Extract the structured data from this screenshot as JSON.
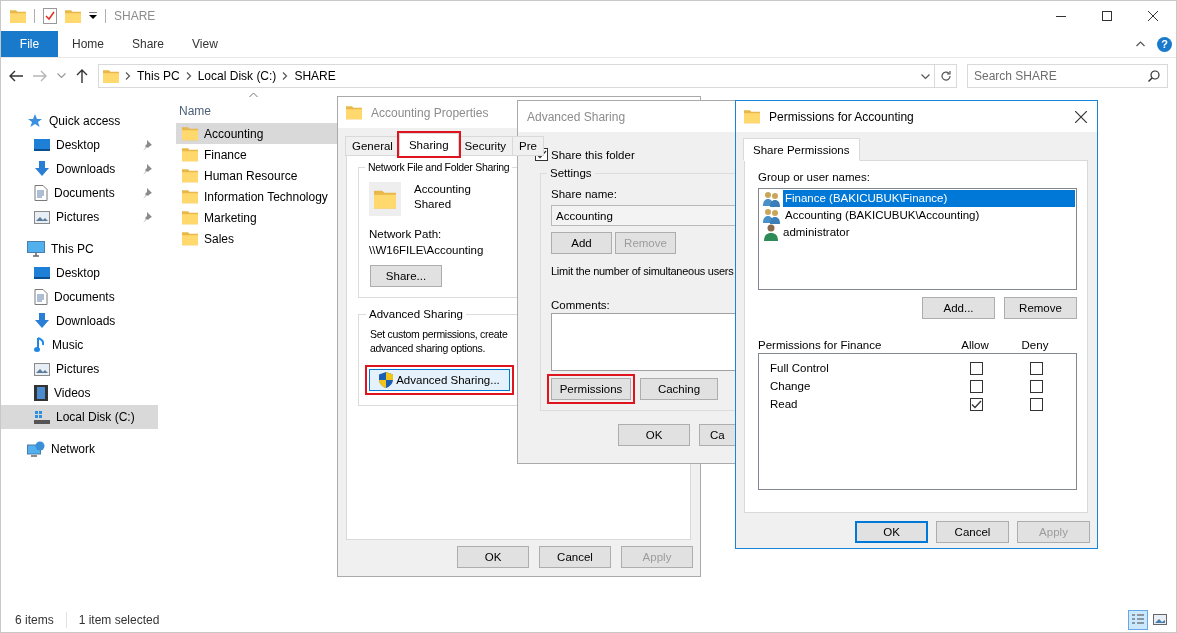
{
  "explorer": {
    "title": "SHARE",
    "ribbon_tabs": [
      {
        "label": "File",
        "kind": "file"
      },
      {
        "label": "Home",
        "kind": "tab"
      },
      {
        "label": "Share",
        "kind": "tab"
      },
      {
        "label": "View",
        "kind": "tab"
      }
    ],
    "help": "?",
    "breadcrumb": [
      "This PC",
      "Local Disk (C:)",
      "SHARE"
    ],
    "search": {
      "placeholder": "Search SHARE"
    },
    "nav": [
      {
        "label": "Quick access",
        "kind": "star",
        "selected": false,
        "children": [
          {
            "label": "Desktop",
            "kind": "desktop",
            "pinned": true,
            "selected": false
          },
          {
            "label": "Downloads",
            "kind": "downloads",
            "pinned": true,
            "selected": false
          },
          {
            "label": "Documents",
            "kind": "documents",
            "pinned": true,
            "selected": false
          },
          {
            "label": "Pictures",
            "kind": "pictures",
            "pinned": true,
            "selected": false
          }
        ]
      },
      {
        "label": "This PC",
        "kind": "pc",
        "selected": false,
        "children": [
          {
            "label": "Desktop",
            "kind": "desktop",
            "pinned": false,
            "selected": false
          },
          {
            "label": "Documents",
            "kind": "documents",
            "pinned": false,
            "selected": false
          },
          {
            "label": "Downloads",
            "kind": "downloads",
            "pinned": false,
            "selected": false
          },
          {
            "label": "Music",
            "kind": "music",
            "pinned": false,
            "selected": false
          },
          {
            "label": "Pictures",
            "kind": "pictures",
            "pinned": false,
            "selected": false
          },
          {
            "label": "Videos",
            "kind": "videos",
            "pinned": false,
            "selected": false
          },
          {
            "label": "Local Disk (C:)",
            "kind": "disk",
            "pinned": false,
            "selected": true
          }
        ]
      },
      {
        "label": "Network",
        "kind": "network",
        "selected": false
      }
    ],
    "column_header": "Name",
    "files": [
      {
        "name": "Accounting",
        "selected": true
      },
      {
        "name": "Finance",
        "selected": false
      },
      {
        "name": "Human Resource",
        "selected": false
      },
      {
        "name": "Information Technology",
        "selected": false
      },
      {
        "name": "Marketing",
        "selected": false
      },
      {
        "name": "Sales",
        "selected": false
      }
    ],
    "status_bar": {
      "count": "6 items",
      "selection": "1 item selected"
    }
  },
  "properties_dialog": {
    "title": "Accounting Properties",
    "tabs": [
      {
        "label": "General",
        "selected": false,
        "highlighted": false
      },
      {
        "label": "Sharing",
        "selected": true,
        "highlighted": true
      },
      {
        "label": "Security",
        "selected": false,
        "highlighted": false
      },
      {
        "label": "Pre",
        "selected": false,
        "highlighted": false
      }
    ],
    "network_sharing": {
      "heading": "Network File and Folder Sharing",
      "folder_name": "Accounting",
      "status": "Shared",
      "path_label": "Network Path:",
      "path": "\\\\W16FILE\\Accounting",
      "share_button": "Share..."
    },
    "advanced_sharing": {
      "heading": "Advanced Sharing",
      "description": [
        "Set custom permissions, create",
        "advanced sharing options."
      ],
      "button": {
        "label": "Advanced Sharing...",
        "highlighted": true
      }
    },
    "buttons": [
      {
        "label": "OK",
        "disabled": false
      },
      {
        "label": "Cancel",
        "disabled": false
      },
      {
        "label": "Apply",
        "disabled": true
      }
    ]
  },
  "advanced_sharing_dialog": {
    "title": "Advanced Sharing",
    "share_checkbox": {
      "label": "Share this folder",
      "checked": true
    },
    "settings_heading": "Settings",
    "share_name_label": "Share name:",
    "share_name": "Accounting",
    "name_buttons": [
      {
        "label": "Add",
        "disabled": false
      },
      {
        "label": "Remove",
        "disabled": true
      }
    ],
    "limit_text": "Limit the number of simultaneous users",
    "comments_label": "Comments:",
    "action_buttons": [
      {
        "label": "Permissions",
        "highlighted": true
      },
      {
        "label": "Caching",
        "highlighted": false
      }
    ],
    "buttons": [
      {
        "label": "OK"
      },
      {
        "label": "Ca"
      }
    ]
  },
  "permissions_dialog": {
    "title": "Permissions for Accounting",
    "tab": {
      "label": "Share Permissions",
      "selected": true
    },
    "group_label": "Group or user names:",
    "principals": [
      {
        "name": "Finance (BAKICUBUK\\Finance)",
        "kind": "group",
        "selected": true
      },
      {
        "name": "Accounting (BAKICUBUK\\Accounting)",
        "kind": "group",
        "selected": false
      },
      {
        "name": "administrator",
        "kind": "user",
        "selected": false
      }
    ],
    "principal_buttons": [
      "Add...",
      "Remove"
    ],
    "permissions_label": "Permissions for Finance",
    "columns": [
      "Allow",
      "Deny"
    ],
    "permissions": [
      {
        "name": "Full Control",
        "allow": false,
        "deny": false
      },
      {
        "name": "Change",
        "allow": false,
        "deny": false
      },
      {
        "name": "Read",
        "allow": true,
        "deny": false
      }
    ],
    "buttons": [
      {
        "label": "OK",
        "default": true,
        "disabled": false
      },
      {
        "label": "Cancel",
        "default": false,
        "disabled": false
      },
      {
        "label": "Apply",
        "default": false,
        "disabled": true
      }
    ]
  }
}
